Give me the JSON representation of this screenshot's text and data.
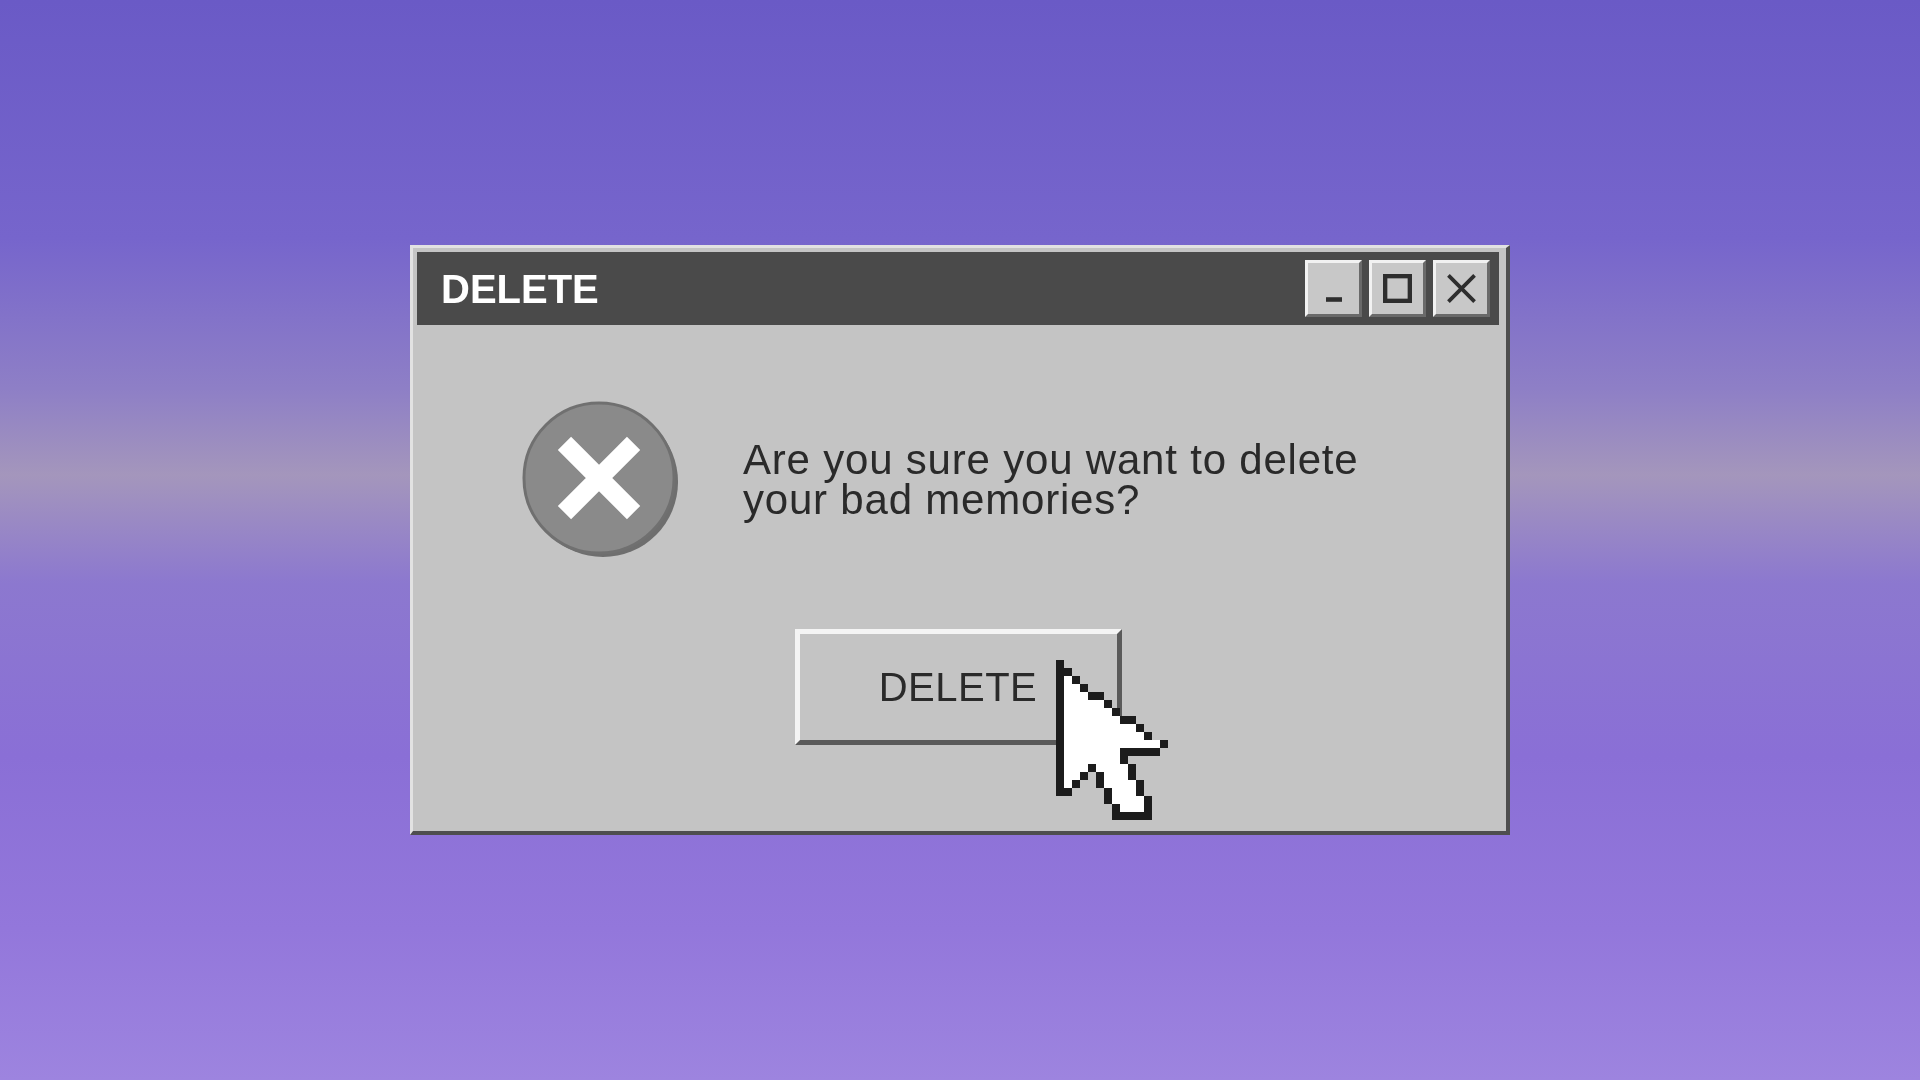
{
  "window": {
    "title": "DELETE"
  },
  "dialog": {
    "message": "Are you sure you want to delete your bad memories?",
    "buttons": [
      {
        "label": "DELETE"
      }
    ]
  }
}
